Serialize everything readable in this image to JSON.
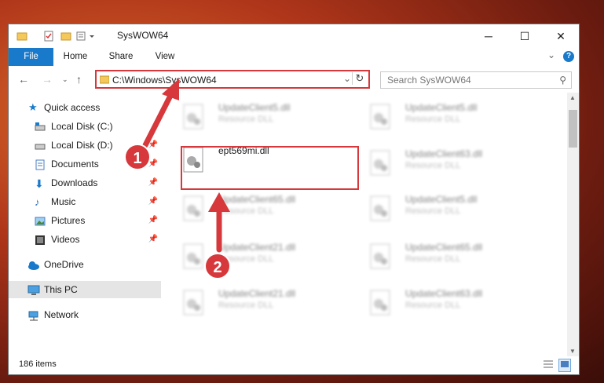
{
  "window": {
    "title": "SysWOW64",
    "minimize": "─",
    "maximize": "☐",
    "close": "✕"
  },
  "ribbon": {
    "tabs": [
      "File",
      "Home",
      "Share",
      "View"
    ],
    "expand": "⌄",
    "help": "?"
  },
  "address": {
    "path": "C:\\Windows\\SysWOW64",
    "dropdown": "⌄",
    "refresh": "↻"
  },
  "search": {
    "placeholder": "Search SysWOW64"
  },
  "nav": {
    "quick_access": "Quick access",
    "items": [
      {
        "label": "Local Disk (C:)",
        "icon": "disk-icon",
        "pinned": false
      },
      {
        "label": "Local Disk (D:)",
        "icon": "disk-icon",
        "pinned": true
      },
      {
        "label": "Documents",
        "icon": "documents-icon",
        "pinned": true
      },
      {
        "label": "Downloads",
        "icon": "downloads-icon",
        "pinned": true
      },
      {
        "label": "Music",
        "icon": "music-icon",
        "pinned": true
      },
      {
        "label": "Pictures",
        "icon": "pictures-icon",
        "pinned": true
      },
      {
        "label": "Videos",
        "icon": "videos-icon",
        "pinned": true
      }
    ],
    "onedrive": "OneDrive",
    "this_pc": "This PC",
    "network": "Network"
  },
  "files": {
    "highlighted": "ept569mi.dll",
    "left_column": [
      {
        "name": "UpdateClient5.dll",
        "type": "Resource DLL"
      },
      {
        "name": "UpdateClient65.dll",
        "type": "Resource DLL"
      },
      {
        "name": "UpdateClient21.dll",
        "type": "Resource DLL"
      },
      {
        "name": "UpdateClient21.dll",
        "type": "Resource DLL"
      }
    ],
    "right_column": [
      {
        "name": "UpdateClient5.dll",
        "type": "Resource DLL"
      },
      {
        "name": "UpdateClient63.dll",
        "type": "Resource DLL"
      },
      {
        "name": "UpdateClient5.dll",
        "type": "Resource DLL"
      },
      {
        "name": "UpdateClient65.dll",
        "type": "Resource DLL"
      },
      {
        "name": "UpdateClient63.dll",
        "type": "Resource DLL"
      }
    ]
  },
  "status": {
    "count": "186 items"
  },
  "annotations": {
    "step1": "1",
    "step2": "2",
    "color": "#d6383b"
  }
}
